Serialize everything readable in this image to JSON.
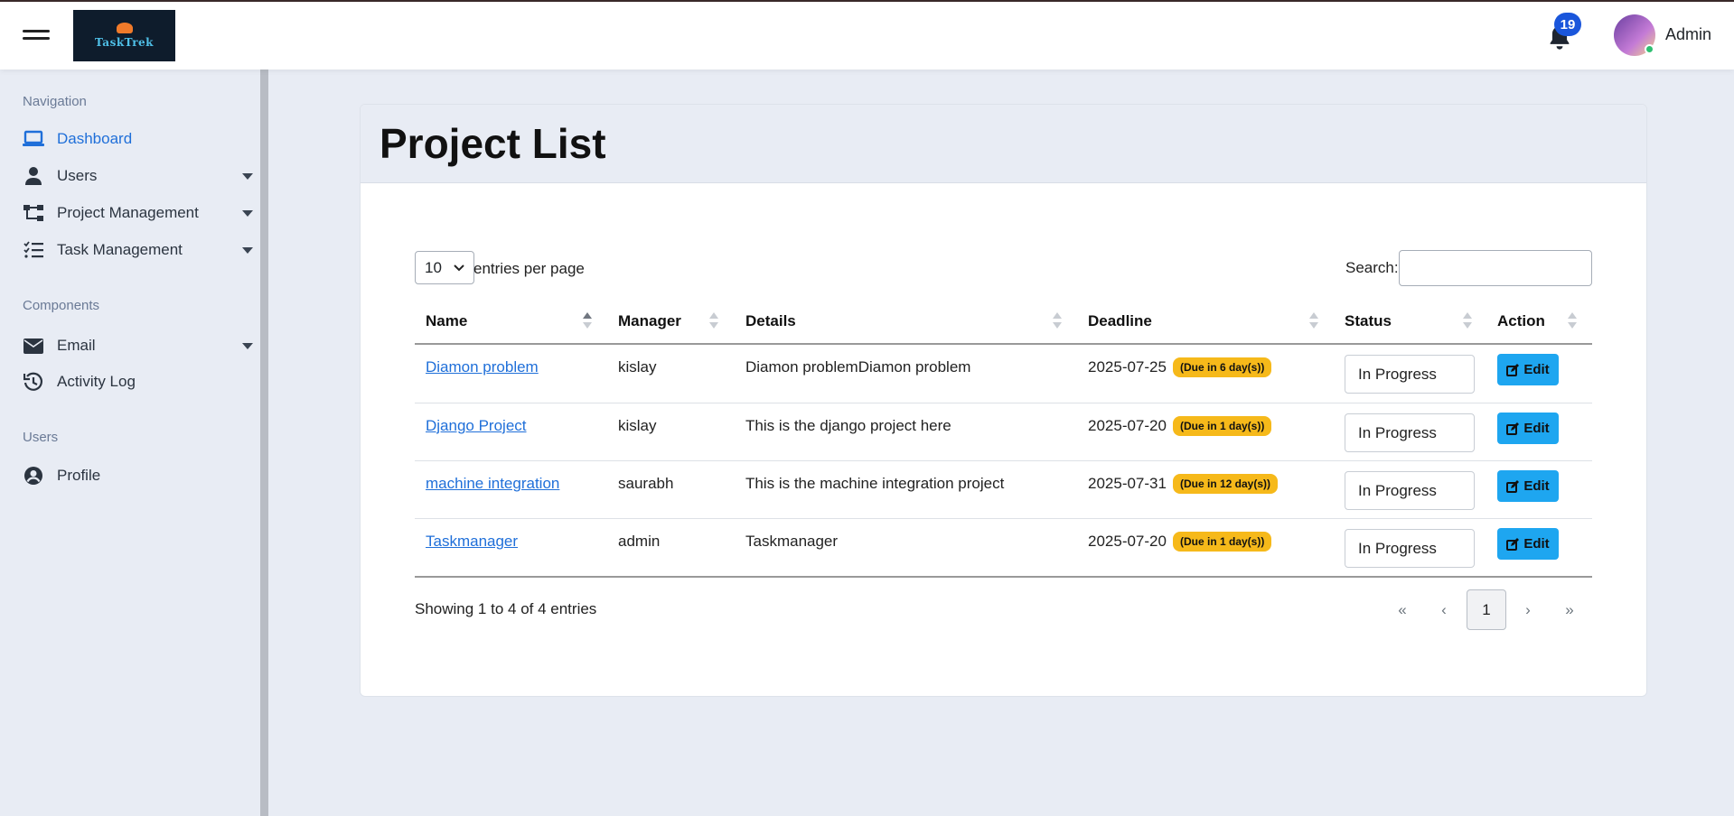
{
  "header": {
    "logo_text": "TaskTrek",
    "notification_count": "19",
    "user_name": "Admin"
  },
  "sidebar": {
    "sections": [
      {
        "heading": "Navigation",
        "items": [
          {
            "label": "Dashboard",
            "icon": "laptop-icon",
            "active": true
          },
          {
            "label": "Users",
            "icon": "user-icon",
            "has_submenu": true
          },
          {
            "label": "Project Management",
            "icon": "sitemap-icon",
            "has_submenu": true
          },
          {
            "label": "Task Management",
            "icon": "list-check-icon",
            "has_submenu": true
          }
        ]
      },
      {
        "heading": "Components",
        "items": [
          {
            "label": "Email",
            "icon": "envelope-icon",
            "has_submenu": true
          },
          {
            "label": "Activity Log",
            "icon": "history-icon"
          }
        ]
      },
      {
        "heading": "Users",
        "items": [
          {
            "label": "Profile",
            "icon": "user-circle-icon"
          }
        ]
      }
    ]
  },
  "main": {
    "title": "Project List",
    "entries_per_page": {
      "value": "10",
      "label": "entries per page"
    },
    "search": {
      "label": "Search:",
      "value": ""
    },
    "columns": [
      "Name",
      "Manager",
      "Details",
      "Deadline",
      "Status",
      "Action"
    ],
    "sorted_column": "Name",
    "rows": [
      {
        "name": "Diamon problem",
        "manager": "kislay",
        "details": "Diamon problemDiamon problem",
        "deadline": "2025-07-25",
        "due": "(Due in 6 day(s))",
        "status": "In Progress",
        "action": "Edit"
      },
      {
        "name": "Django Project",
        "manager": "kislay",
        "details": "This is the django project here",
        "deadline": "2025-07-20",
        "due": "(Due in 1 day(s))",
        "status": "In Progress",
        "action": "Edit"
      },
      {
        "name": "machine integration",
        "manager": "saurabh",
        "details": "This is the machine integration project",
        "deadline": "2025-07-31",
        "due": "(Due in 12 day(s))",
        "status": "In Progress",
        "action": "Edit"
      },
      {
        "name": "Taskmanager",
        "manager": "admin",
        "details": "Taskmanager",
        "deadline": "2025-07-20",
        "due": "(Due in 1 day(s))",
        "status": "In Progress",
        "action": "Edit"
      }
    ],
    "info": "Showing 1 to 4 of 4 entries",
    "pagination": {
      "first": "«",
      "prev": "‹",
      "current": "1",
      "next": "›",
      "last": "»"
    }
  },
  "colors": {
    "accent": "#1f6fd9",
    "badge": "#f6b91a",
    "edit_button": "#1ea6f0",
    "notification_badge": "#1a56db"
  }
}
